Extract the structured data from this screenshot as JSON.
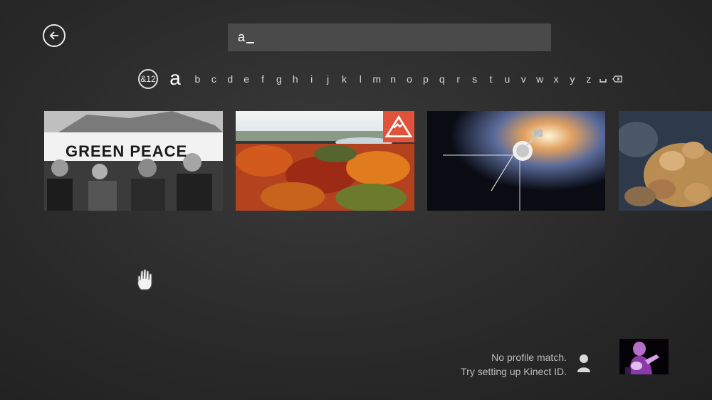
{
  "search": {
    "query": "a"
  },
  "keyboard": {
    "symbols_label": "&12",
    "active_letter": "a",
    "letters": [
      "b",
      "c",
      "d",
      "e",
      "f",
      "g",
      "h",
      "i",
      "j",
      "k",
      "l",
      "m",
      "n",
      "o",
      "p",
      "q",
      "r",
      "s",
      "t",
      "u",
      "v",
      "w",
      "x",
      "y",
      "z"
    ]
  },
  "results": [
    {
      "id": "greenpeace",
      "text": "GREEN PEACE"
    },
    {
      "id": "autumn-forest"
    },
    {
      "id": "voyager-space"
    },
    {
      "id": "coral"
    }
  ],
  "profile": {
    "line1": "No profile match.",
    "line2": "Try setting up Kinect ID."
  },
  "colors": {
    "accent": "#e0533a",
    "search_bg": "#4a4a4a"
  }
}
